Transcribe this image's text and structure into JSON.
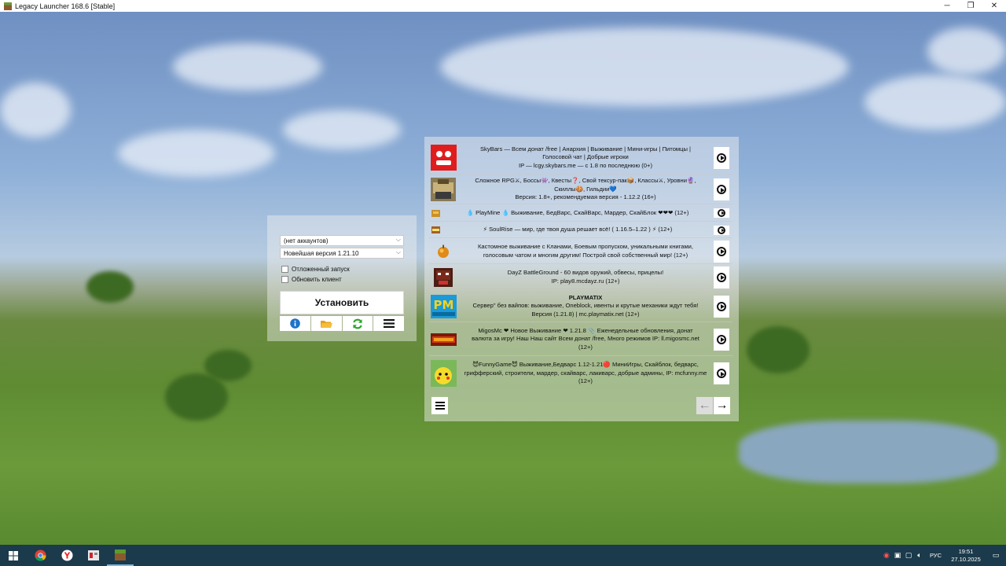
{
  "window": {
    "title": "Legacy Launcher 168.6 [Stable]",
    "controls": [
      "─",
      "❐",
      "✕"
    ]
  },
  "launcher": {
    "account_select": "(нет аккаунтов)",
    "version_select": "Новейшая версия 1.21.10",
    "delayed_launch_label": "Отложенный запуск",
    "update_client_label": "Обновить клиент",
    "install_button": "Установить",
    "toolbar_icons": [
      "info-icon",
      "folder-icon",
      "refresh-icon",
      "menu-icon"
    ]
  },
  "servers": [
    {
      "lines": [
        "SkyBars — Всем донат /free | Анархия | Выживание | Мини-игры | Питомцы |",
        "Голосовой чат | Добрые игроки",
        "IP — lcgy.skybars.me — с 1.8 по последнюю (0+)"
      ],
      "logo": "skybars-logo"
    },
    {
      "lines": [
        "Сложное RPG⚔, Боссы👾, Квесты❓, Свой тексур-пак📦, Классы⚔, Уровни🔮,",
        "Скиллы🍪, Гильдии💙",
        "Версия: 1.8+, рекомендуемая версия - 1.12.2 (16+)"
      ],
      "logo": "rpg-logo"
    },
    {
      "lines": [
        "💧 PlayMine 💧 Выживание, БедВарс, СкайВарс, Мардер, СкайБлок ❤❤❤ (12+)"
      ],
      "logo": "playmine-logo"
    },
    {
      "lines": [
        "⚡ SoulRise — мир, где твоя душа решает всё! ( 1.16.5–1.22 ) ⚡ (12+)"
      ],
      "logo": "soulrise-logo"
    },
    {
      "lines": [
        "Кастомное выживание с Кланами, Боевым пропуском, уникальными книгами,",
        "голосовым чатом и многим другим! Построй свой собственный мир! (12+)"
      ],
      "logo": "apple-logo"
    },
    {
      "lines": [
        "DayZ BattleGround - 60 видов оружий, обвесы, прицелы!",
        "IP: play8.mcdayz.ru (12+)"
      ],
      "logo": "dayz-logo"
    },
    {
      "lines": [
        "PLAYMATIX",
        "Сервер\" без вайпов: выживание, Oneblock, ивенты и крутые механики ждут тебя!",
        "Версия (1.21.8) | mc.playmatix.net (12+)"
      ],
      "logo": "playmatix-logo"
    },
    {
      "lines": [
        "MigosMc ❤ Новое   Выживание ❤   1.21.8 📎 Еженедельные обновления, донат",
        "валюта за игру! Наш Наш сайт Всем донат /free, Много режимов IP: ll.migosmc.net",
        "(12+)"
      ],
      "logo": "migosmc-logo"
    },
    {
      "lines": [
        "😈FunnyGame😈 Выживание,Бедварс 1.12-1.21🔴 МиниИгры, Скайблок, бедварс,",
        "грифферский, строители, мардер, скайварс, лакиварс, добрые админы, IP: mcfunny.me",
        "(12+)"
      ],
      "logo": "funnygame-logo"
    }
  ],
  "navigation": {
    "prev": "←",
    "next": "→"
  },
  "taskbar": {
    "lang": "РУС",
    "time": "19:51",
    "date": "27.10.2025"
  }
}
